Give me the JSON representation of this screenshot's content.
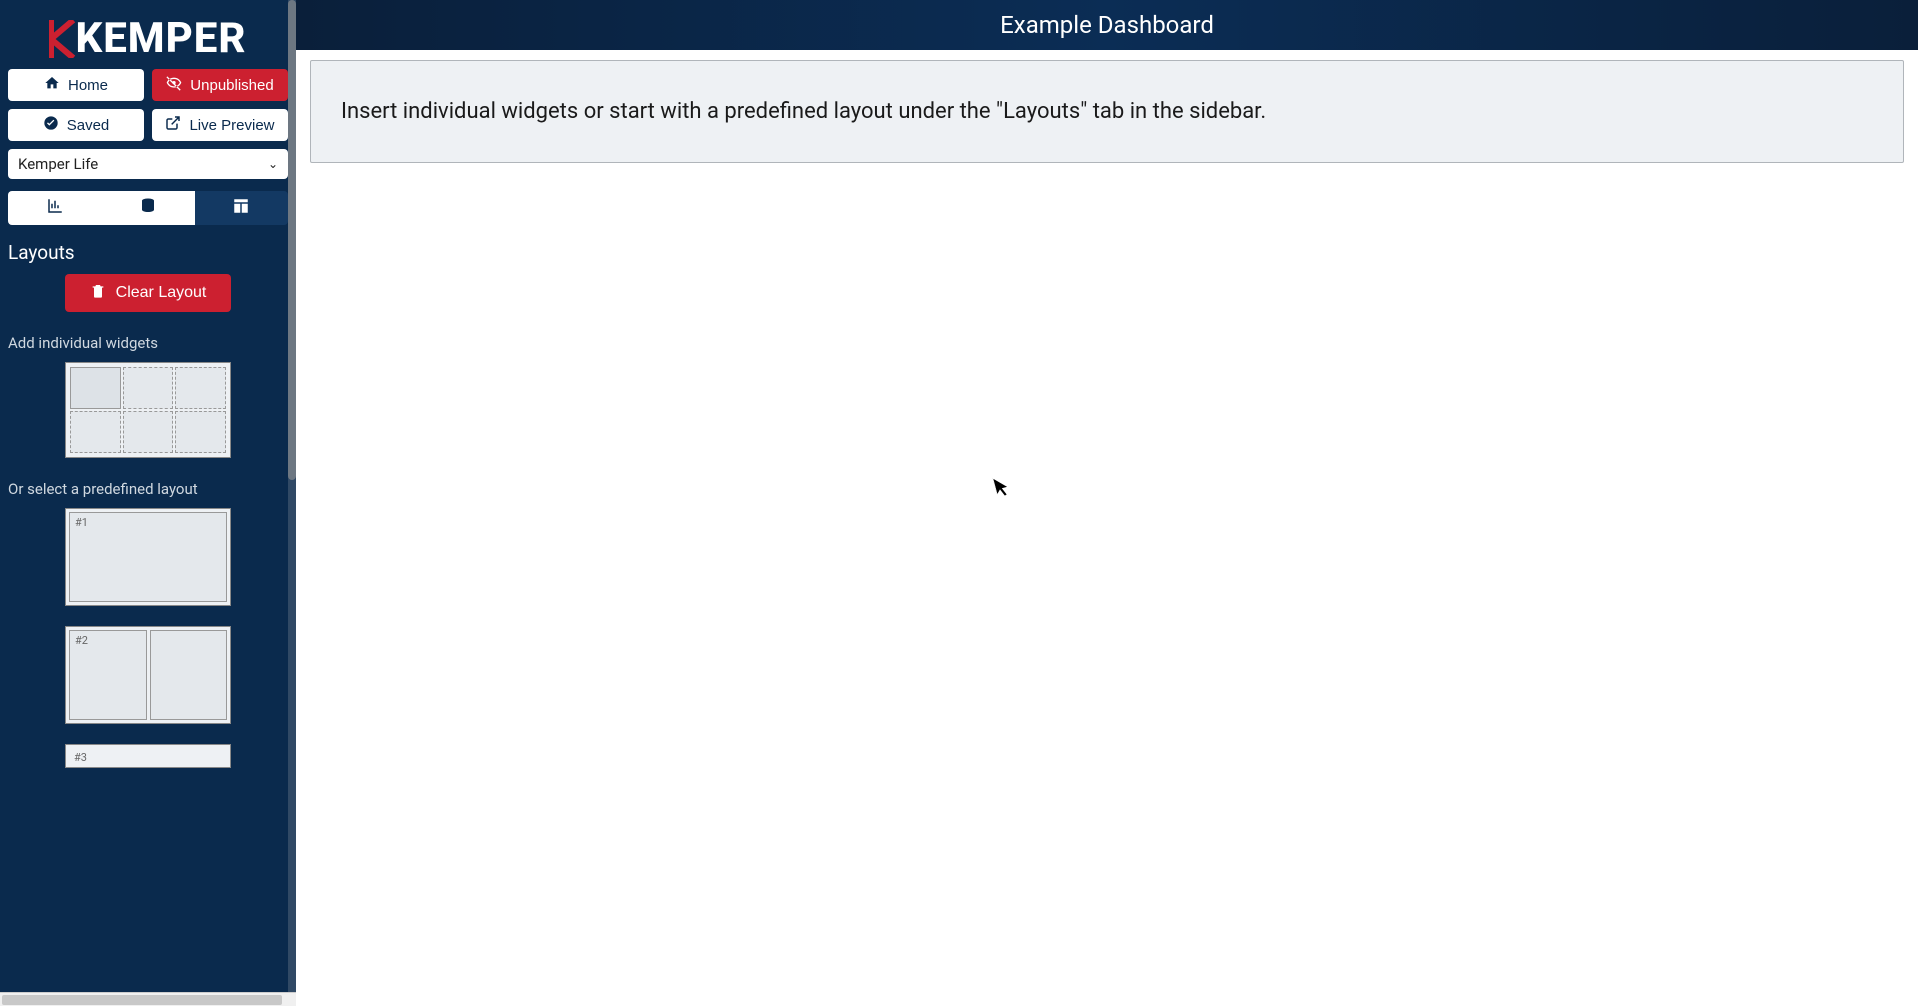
{
  "brand": {
    "name": "KEMPER"
  },
  "header": {
    "title": "Example Dashboard"
  },
  "buttons": {
    "home": "Home",
    "unpublished": "Unpublished",
    "saved": "Saved",
    "live_preview": "Live Preview",
    "clear_layout": "Clear Layout"
  },
  "dropdown": {
    "selected": "Kemper Life"
  },
  "sidebar": {
    "section_title": "Layouts",
    "add_widgets_label": "Add individual widgets",
    "predefined_label": "Or select a predefined layout",
    "layouts": [
      {
        "id": "#1"
      },
      {
        "id": "#2"
      },
      {
        "id": "#3"
      }
    ]
  },
  "notice": {
    "text": "Insert individual widgets or start with a predefined layout under the \"Layouts\" tab in the sidebar."
  },
  "colors": {
    "accent_red": "#cc2030",
    "sidebar_bg": "#0a2a4d",
    "topbar_grad_start": "#0a1f3a",
    "topbar_grad_mid": "#0b2d55"
  }
}
